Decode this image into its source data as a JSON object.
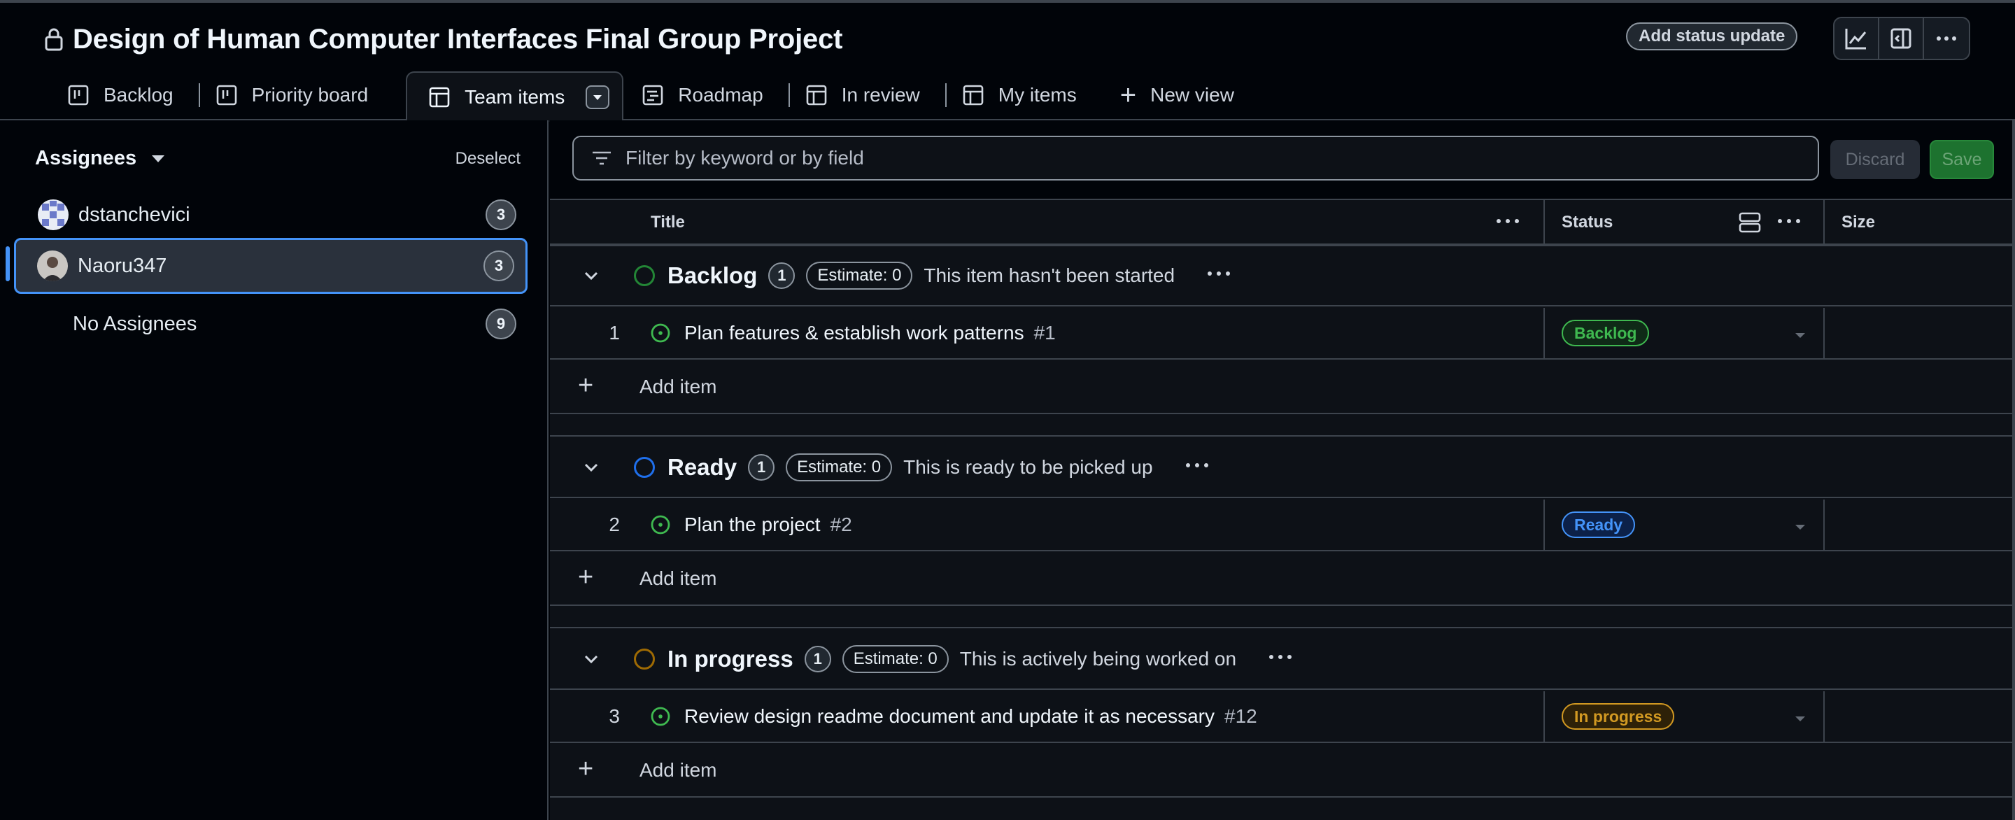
{
  "header": {
    "title": "Design of Human Computer Interfaces Final Group Project",
    "status_update_label": "Add status update",
    "icons": [
      "insights-icon",
      "side-panel-icon",
      "more-icon"
    ]
  },
  "tabs": [
    {
      "label": "Backlog",
      "icon": "board-icon",
      "active": false
    },
    {
      "label": "Priority board",
      "icon": "board-icon",
      "active": false
    },
    {
      "label": "Team items",
      "icon": "table-icon",
      "active": true
    },
    {
      "label": "Roadmap",
      "icon": "roadmap-icon",
      "active": false
    },
    {
      "label": "In review",
      "icon": "table-icon",
      "active": false
    },
    {
      "label": "My items",
      "icon": "table-icon",
      "active": false
    }
  ],
  "new_view_label": "New view",
  "sidebar": {
    "title": "Assignees",
    "deselect_label": "Deselect",
    "items": [
      {
        "label": "dstanchevici",
        "count": "3",
        "selected": false
      },
      {
        "label": "Naoru347",
        "count": "3",
        "selected": true
      },
      {
        "label": "No Assignees",
        "count": "9",
        "selected": false
      }
    ]
  },
  "filter": {
    "placeholder": "Filter by keyword or by field",
    "discard_label": "Discard",
    "save_label": "Save"
  },
  "columns": {
    "title": "Title",
    "status": "Status",
    "size": "Size"
  },
  "groups": [
    {
      "name": "Backlog",
      "count": "1",
      "estimate": "Estimate: 0",
      "description": "This item hasn't been started",
      "color": "#238636",
      "items": [
        {
          "num": "1",
          "title": "Plan features & establish work patterns",
          "issue": "#1",
          "status": "Backlog"
        }
      ]
    },
    {
      "name": "Ready",
      "count": "1",
      "estimate": "Estimate: 0",
      "description": "This is ready to be picked up",
      "color": "#1f6feb",
      "items": [
        {
          "num": "2",
          "title": "Plan the project",
          "issue": "#2",
          "status": "Ready"
        }
      ]
    },
    {
      "name": "In progress",
      "count": "1",
      "estimate": "Estimate: 0",
      "description": "This is actively being worked on",
      "color": "#9e6a03",
      "items": [
        {
          "num": "3",
          "title": "Review design readme document and update it as necessary",
          "issue": "#12",
          "status": "In progress"
        }
      ]
    }
  ],
  "add_item_label": "Add item",
  "colors": {
    "accent_blue": "#4493f8",
    "backlog_pill": "#3fb950",
    "ready_pill": "#4493f8",
    "in_progress_pill": "#d29922",
    "issue_open": "#3fb950"
  }
}
